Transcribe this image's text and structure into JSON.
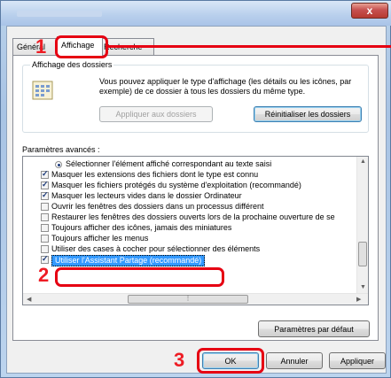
{
  "window": {
    "close_label": "x"
  },
  "tabs": [
    {
      "label": "Général"
    },
    {
      "label": "Affichage"
    },
    {
      "label": "Recherche"
    }
  ],
  "folder_view": {
    "legend": "Affichage des dossiers",
    "description": "Vous pouvez appliquer le type d'affichage (les détails ou les icônes, par exemple) de ce dossier à tous les dossiers du même type.",
    "apply_button": "Appliquer aux dossiers",
    "reset_button": "Réinitialiser les dossiers"
  },
  "advanced": {
    "label": "Paramètres avancés :",
    "items": [
      {
        "type": "radio",
        "checked": true,
        "label": "Sélectionner l'élément affiché correspondant au texte saisi"
      },
      {
        "type": "checkbox",
        "checked": true,
        "label": "Masquer les extensions des fichiers dont le type est connu"
      },
      {
        "type": "checkbox",
        "checked": true,
        "label": "Masquer les fichiers protégés du système d'exploitation (recommandé)"
      },
      {
        "type": "checkbox",
        "checked": true,
        "label": "Masquer les lecteurs vides dans le dossier Ordinateur"
      },
      {
        "type": "checkbox",
        "checked": false,
        "label": "Ouvrir les fenêtres des dossiers dans un processus différent"
      },
      {
        "type": "checkbox",
        "checked": false,
        "label": "Restaurer les fenêtres des dossiers ouverts lors de la prochaine ouverture de se"
      },
      {
        "type": "checkbox",
        "checked": false,
        "label": "Toujours afficher des icônes, jamais des miniatures"
      },
      {
        "type": "checkbox",
        "checked": false,
        "label": "Toujours afficher les menus"
      },
      {
        "type": "checkbox",
        "checked": false,
        "label": "Utiliser des cases à cocher pour sélectionner des éléments"
      },
      {
        "type": "checkbox",
        "checked": true,
        "label": "Utiliser l'Assistant Partage (recommandé)"
      }
    ],
    "default_button": "Paramètres par défaut"
  },
  "footer": {
    "ok": "OK",
    "cancel": "Annuler",
    "apply": "Appliquer"
  },
  "callouts": [
    "1",
    "2",
    "3"
  ],
  "colors": {
    "callout_red": "#e60012",
    "selection_blue": "#3399ff"
  }
}
